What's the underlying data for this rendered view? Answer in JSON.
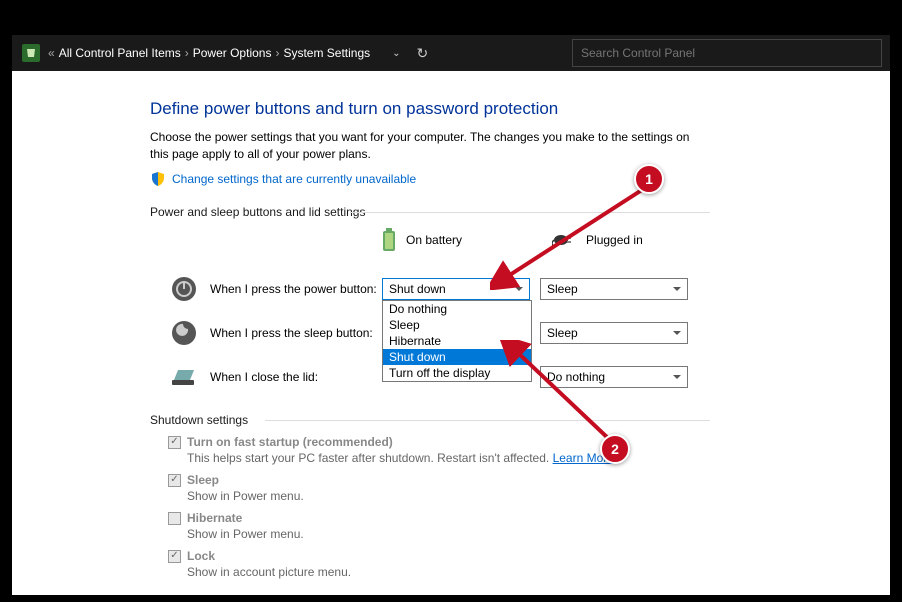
{
  "breadcrumb": {
    "item1": "All Control Panel Items",
    "item2": "Power Options",
    "item3": "System Settings"
  },
  "search": {
    "placeholder": "Search Control Panel"
  },
  "page": {
    "heading": "Define power buttons and turn on password protection",
    "description": "Choose the power settings that you want for your computer. The changes you make to the settings on this page apply to all of your power plans.",
    "unavailable_link": "Change settings that are currently unavailable",
    "section1_title": "Power and sleep buttons and lid settings",
    "col_battery": "On battery",
    "col_plugged": "Plugged in",
    "rows": {
      "power": {
        "label": "When I press the power button:",
        "battery": "Shut down",
        "plugged": "Sleep"
      },
      "sleep": {
        "label": "When I press the sleep button:",
        "battery": "",
        "plugged": "Sleep"
      },
      "lid": {
        "label": "When I close the lid:",
        "battery": "",
        "plugged": "Do nothing"
      }
    },
    "dropdown_options": {
      "opt0": "Do nothing",
      "opt1": "Sleep",
      "opt2": "Hibernate",
      "opt3": "Shut down",
      "opt4": "Turn off the display"
    },
    "section2_title": "Shutdown settings",
    "shutdown": {
      "fast_label": "Turn on fast startup (recommended)",
      "fast_desc1": "This helps start your PC faster after shutdown. Restart isn't affected. ",
      "fast_desc2": "Learn More",
      "sleep_label": "Sleep",
      "sleep_desc": "Show in Power menu.",
      "hib_label": "Hibernate",
      "hib_desc": "Show in Power menu.",
      "lock_label": "Lock",
      "lock_desc": "Show in account picture menu."
    }
  },
  "callouts": {
    "c1": "1",
    "c2": "2"
  }
}
